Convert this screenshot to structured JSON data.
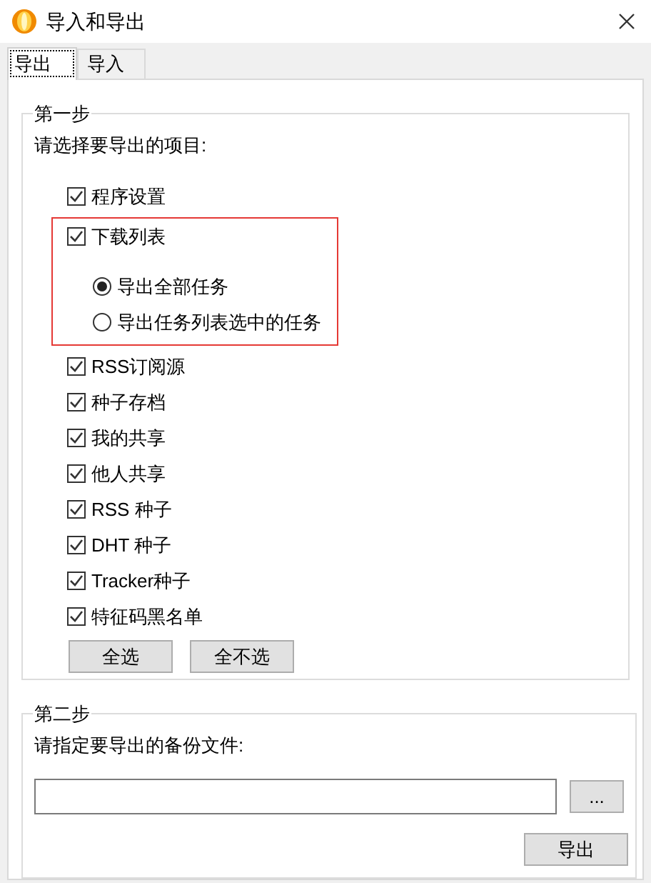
{
  "window": {
    "title": "导入和导出"
  },
  "tabs": [
    {
      "label": "导出",
      "selected": true
    },
    {
      "label": "导入",
      "selected": false
    }
  ],
  "step1": {
    "title": "第一步",
    "prompt": "请选择要导出的项目:",
    "items": [
      {
        "label": "程序设置",
        "checked": true,
        "highlighted": false
      },
      {
        "label": "下载列表",
        "checked": true,
        "highlighted": true,
        "options": [
          {
            "label": "导出全部任务",
            "selected": true
          },
          {
            "label": "导出任务列表选中的任务",
            "selected": false
          }
        ]
      },
      {
        "label": "RSS订阅源",
        "checked": true,
        "highlighted": false
      },
      {
        "label": "种子存档",
        "checked": true,
        "highlighted": false
      },
      {
        "label": "我的共享",
        "checked": true,
        "highlighted": false
      },
      {
        "label": "他人共享",
        "checked": true,
        "highlighted": false
      },
      {
        "label": "RSS 种子",
        "checked": true,
        "highlighted": false
      },
      {
        "label": "DHT 种子",
        "checked": true,
        "highlighted": false
      },
      {
        "label": "Tracker种子",
        "checked": true,
        "highlighted": false
      },
      {
        "label": "特征码黑名单",
        "checked": true,
        "highlighted": false
      }
    ],
    "buttons": [
      "全选",
      "全不选"
    ]
  },
  "step2": {
    "title": "第二步",
    "prompt": "请指定要导出的备份文件:",
    "browse": "...",
    "action": "导出"
  }
}
